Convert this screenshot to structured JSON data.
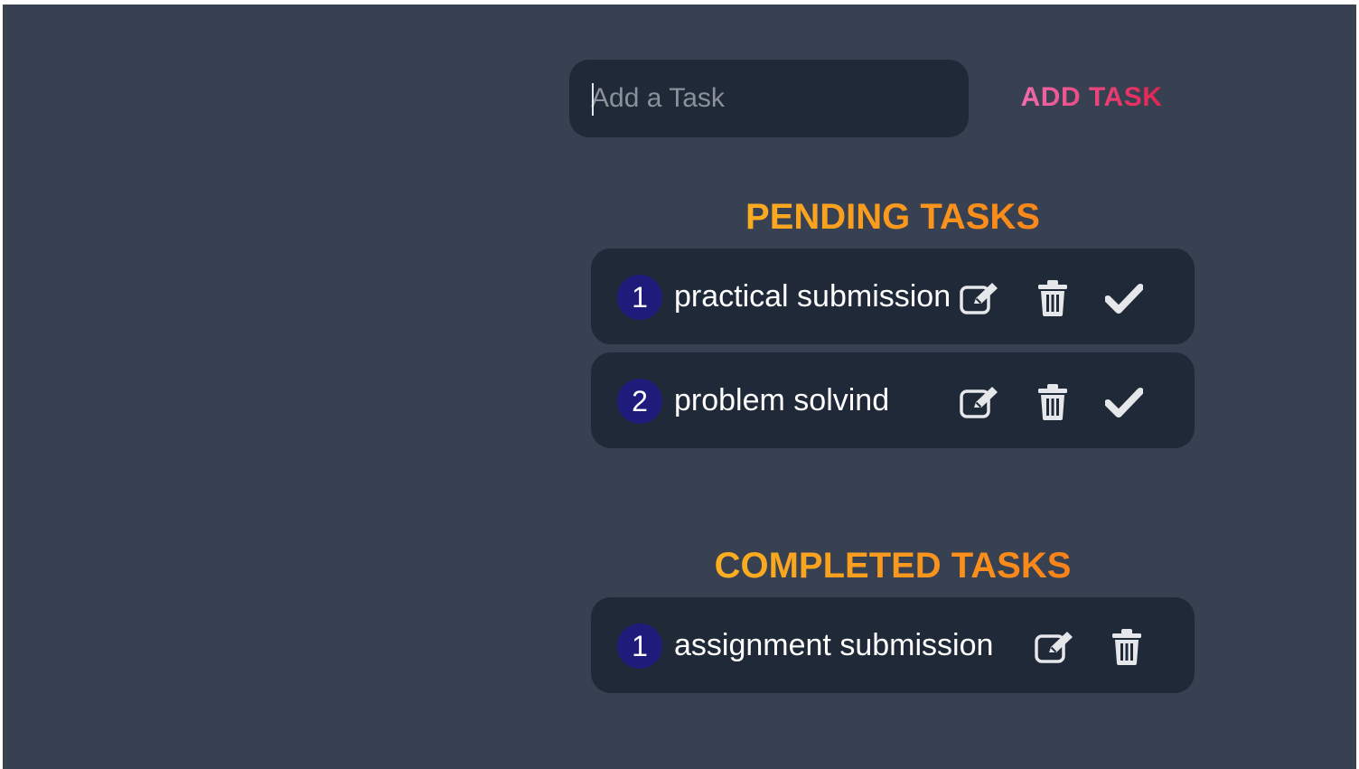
{
  "input": {
    "placeholder": "Add a Task",
    "value": ""
  },
  "add_button": {
    "label": "ADD TASK"
  },
  "pending": {
    "title": "PENDING TASKS",
    "tasks": [
      {
        "number": "1",
        "text": "practical submission",
        "icons": [
          "edit-icon",
          "trash-icon",
          "check-icon"
        ]
      },
      {
        "number": "2",
        "text": "problem solvind",
        "icons": [
          "edit-icon",
          "trash-icon",
          "check-icon"
        ]
      }
    ]
  },
  "completed": {
    "title": "COMPLETED TASKS",
    "tasks": [
      {
        "number": "1",
        "text": "assignment submission",
        "icons": [
          "edit-icon",
          "trash-icon"
        ]
      }
    ]
  },
  "colors": {
    "background": "#374151",
    "panel": "#1f2937",
    "badge": "#1e1b7b",
    "title_gradient": [
      "#fbbf24",
      "#f97316"
    ],
    "add_button_gradient": [
      "#f472b6",
      "#e11d48"
    ],
    "icon": "#e5e7eb"
  }
}
